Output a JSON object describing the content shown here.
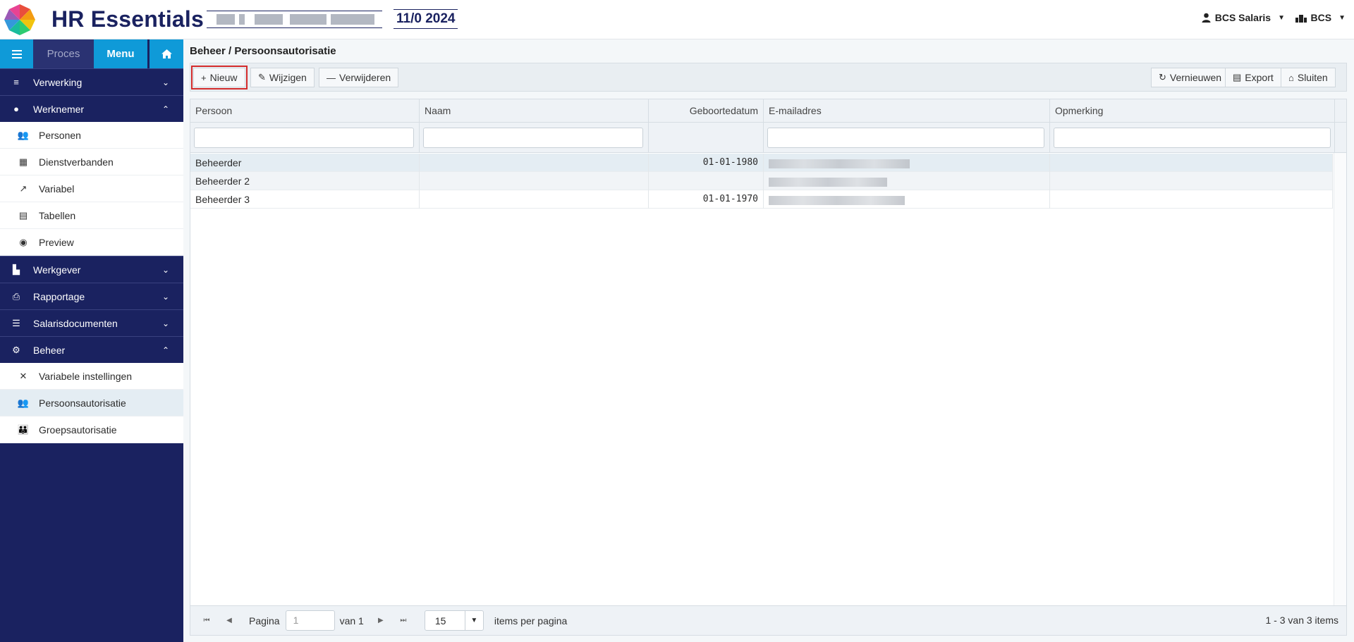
{
  "header": {
    "app_title": "HR Essentials",
    "period": "11/0 2024",
    "user_label": "BCS Salaris",
    "org_label": "BCS",
    "icons": [
      "logo-icon",
      "user-icon",
      "org-icon",
      "caret-down-icon"
    ]
  },
  "sidebar": {
    "tabs": {
      "proces": "Proces",
      "menu": "Menu"
    },
    "sections": {
      "verwerking": "Verwerking",
      "werknemer": "Werknemer",
      "werkgever": "Werkgever",
      "rapportage": "Rapportage",
      "salarisdocumenten": "Salarisdocumenten",
      "beheer": "Beheer"
    },
    "werknemer_items": [
      "Personen",
      "Dienstverbanden",
      "Variabel",
      "Tabellen",
      "Preview"
    ],
    "beheer_items": [
      "Variabele instellingen",
      "Persoonsautorisatie",
      "Groepsautorisatie"
    ],
    "active_item": "Persoonsautorisatie"
  },
  "main": {
    "breadcrumb": "Beheer / Persoonsautorisatie",
    "toolbar": {
      "nieuw": "Nieuw",
      "wijzigen": "Wijzigen",
      "verwijderen": "Verwijderen",
      "vernieuwen": "Vernieuwen",
      "export": "Export",
      "sluiten": "Sluiten"
    },
    "grid": {
      "columns": [
        "Persoon",
        "Naam",
        "Geboortedatum",
        "E-mailadres",
        "Opmerking"
      ],
      "rows": [
        {
          "persoon": "Beheerder",
          "naam": "",
          "geboortedatum": "01-01-1980",
          "email": "",
          "opmerking": ""
        },
        {
          "persoon": "Beheerder 2",
          "naam": "",
          "geboortedatum": "",
          "email": "",
          "opmerking": ""
        },
        {
          "persoon": "Beheerder 3",
          "naam": "",
          "geboortedatum": "01-01-1970",
          "email": "",
          "opmerking": ""
        }
      ]
    },
    "pager": {
      "pagina_label": "Pagina",
      "page_value": "1",
      "of_label": "van 1",
      "page_size": "15",
      "items_per_page_label": "items per pagina",
      "info": "1 - 3 van 3 items"
    }
  },
  "colors": {
    "navy": "#1a2260",
    "accent_blue": "#0f9ad8",
    "highlight_red": "#d32b2b"
  }
}
